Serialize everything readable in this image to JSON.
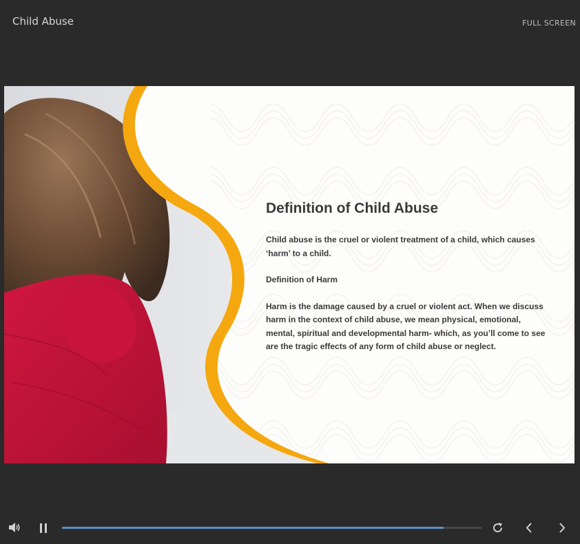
{
  "header": {
    "title": "Child Abuse",
    "fullscreen_label": "FULL SCREEN"
  },
  "slide": {
    "heading": "Definition of Child Abuse",
    "paragraph_1": "Child abuse is the cruel or violent treatment of a child, which causes ‘harm’ to a child.",
    "subheading": "Definition of Harm",
    "paragraph_2": "Harm is the damage caused by a cruel or violent act. When we discuss harm in the context of child abuse, we mean physical, emotional, mental, spiritual and developmental harm- which, as you’ll come to see are the tragic effects of any form of child abuse or neglect.",
    "accent_color": "#f5a70f",
    "photo": {
      "icon": "child-covering-face-photo"
    }
  },
  "controls": {
    "progress_fraction": 0.91,
    "progress_color": "#5b8ec7",
    "icons": {
      "volume": "speaker-icon",
      "pause": "pause-icon",
      "replay": "replay-icon",
      "previous": "chevron-left-icon",
      "next": "chevron-right-icon"
    }
  }
}
